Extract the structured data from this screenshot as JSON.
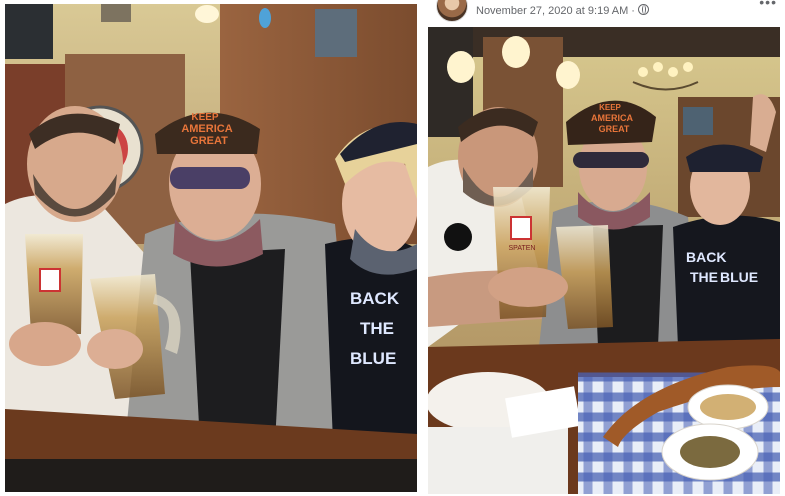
{
  "post": {
    "author": "",
    "timestamp": "November 27, 2020 at 9:19 AM",
    "separator": "·",
    "visibility_icon": "globe-icon",
    "more_icon": "ellipsis-icon"
  },
  "left_photo": {
    "hat_text": [
      "KEEP",
      "AMERICA",
      "GREAT"
    ],
    "shirt_text": [
      "BACK",
      "THE",
      "BLUE"
    ]
  },
  "right_photo": {
    "hat_text": [
      "KEEP",
      "AMERICA",
      "GREAT"
    ],
    "shirt_text": [
      "BACK",
      "THE",
      "BLUE"
    ],
    "mug_brand": "SPATEN"
  },
  "colors": {
    "link": "#385898",
    "meta": "#65676b",
    "wood": "#8a5a35",
    "table": "#6b3a1e"
  }
}
